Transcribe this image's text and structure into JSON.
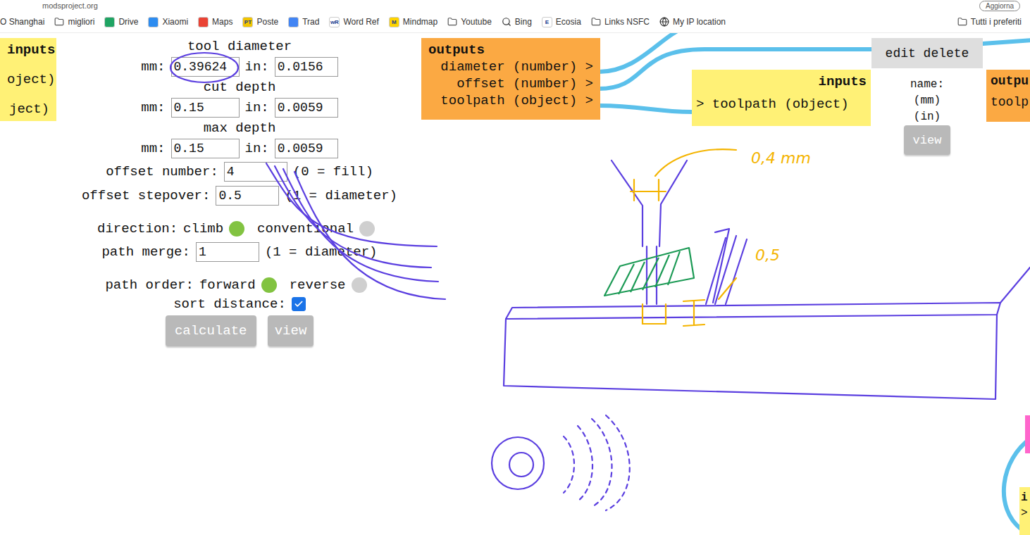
{
  "browser": {
    "address": "modsproject.org",
    "update_button": "Aggiorna",
    "bookmarks": [
      {
        "label": "O Shanghai",
        "kind": "plain"
      },
      {
        "label": "migliori",
        "kind": "folder"
      },
      {
        "label": "Drive",
        "kind": "site",
        "color": "#1fa463",
        "badge": ""
      },
      {
        "label": "Xiaomi",
        "kind": "site",
        "color": "#2d8cf0",
        "badge": ""
      },
      {
        "label": "Maps",
        "kind": "site",
        "color": "#ea4335",
        "badge": ""
      },
      {
        "label": "Poste",
        "kind": "site",
        "color": "#f2c500",
        "badge": "PT"
      },
      {
        "label": "Trad",
        "kind": "site",
        "color": "#4285f4",
        "badge": ""
      },
      {
        "label": "Word Ref",
        "kind": "site",
        "color": "#ffffff",
        "badge": "wR"
      },
      {
        "label": "Mindmap",
        "kind": "site",
        "color": "#ffd400",
        "badge": "M"
      },
      {
        "label": "Youtube",
        "kind": "folder"
      },
      {
        "label": "Bing",
        "kind": "search"
      },
      {
        "label": "Ecosia",
        "kind": "site",
        "color": "#ffffff",
        "badge": "E"
      },
      {
        "label": "Links NSFC",
        "kind": "folder"
      },
      {
        "label": "My IP location",
        "kind": "globe"
      }
    ],
    "all_bookmarks": "Tutti i preferiti"
  },
  "form": {
    "rows": [
      {
        "kind": "pair",
        "title": "tool diameter",
        "mm_label": "mm:",
        "mm": "0.39624",
        "in_label": "in:",
        "in": "0.0156"
      },
      {
        "kind": "pair",
        "title": "cut depth",
        "mm_label": "mm:",
        "mm": "0.15",
        "in_label": "in:",
        "in": "0.0059"
      },
      {
        "kind": "pair",
        "title": "max depth",
        "mm_label": "mm:",
        "mm": "0.15",
        "in_label": "in:",
        "in": "0.0059"
      },
      {
        "kind": "field",
        "label": "offset number:",
        "value": "4",
        "note": "(0 = fill)"
      },
      {
        "kind": "field",
        "label": "offset stepover:",
        "value": "0.5",
        "note": "(1 = diameter)"
      },
      {
        "kind": "radio",
        "label": "direction:",
        "options": [
          {
            "label": "climb",
            "selected": true
          },
          {
            "label": "conventional",
            "selected": false
          }
        ]
      },
      {
        "kind": "field",
        "label": "path merge:",
        "value": "1",
        "note": "(1 = diameter)"
      },
      {
        "kind": "radio",
        "label": "path order:",
        "options": [
          {
            "label": "forward",
            "selected": true
          },
          {
            "label": "reverse",
            "selected": false
          }
        ]
      },
      {
        "kind": "checkbox",
        "label": "sort distance:",
        "checked": true
      },
      {
        "kind": "buttons",
        "buttons": [
          "calculate",
          "view"
        ]
      }
    ]
  },
  "nodes": {
    "left_inputs": {
      "header": "inputs",
      "lines": [
        "oject)",
        "ject)"
      ]
    },
    "outputs": {
      "header": "outputs",
      "lines": [
        "diameter (number) >",
        "offset (number) >",
        "toolpath (object) >"
      ]
    },
    "inputs": {
      "header": "inputs",
      "lines": [
        "> toolpath (object)"
      ]
    },
    "module": {
      "header": "edit delete",
      "lines": [
        "name:",
        "(mm)",
        "(in)"
      ],
      "button": "view"
    },
    "right_outputs": {
      "header": "outpu",
      "lines": [
        "toolp"
      ]
    },
    "bottom_inputs": {
      "header": "i",
      "lines": [
        ">"
      ]
    }
  },
  "annotations": [
    "0,4 mm",
    "0,5"
  ]
}
